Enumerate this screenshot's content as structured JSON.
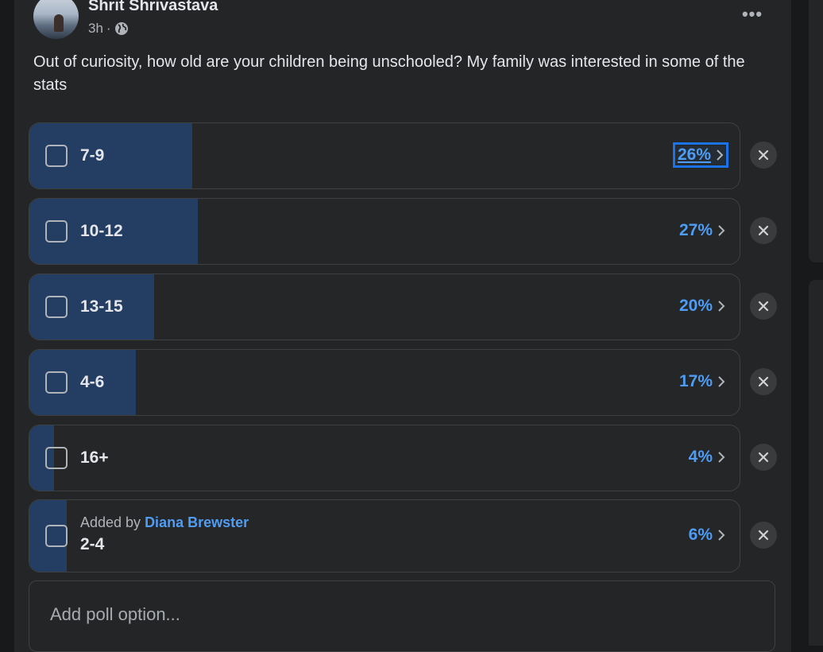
{
  "post": {
    "author": "Shrit Shrivastava",
    "time": "3h",
    "separator": "·",
    "privacy_icon": "globe-icon",
    "more_icon": "more-horizontal-icon",
    "more_label": "•••",
    "question": "Out of curiosity, how old are your children being unschooled? My family was interested in some of the stats"
  },
  "poll": {
    "options": [
      {
        "label": "7-9",
        "percent_text": "26%",
        "percent": 26
      },
      {
        "label": "10-12",
        "percent_text": "27%",
        "percent": 27
      },
      {
        "label": "13-15",
        "percent_text": "20%",
        "percent": 20
      },
      {
        "label": "4-6",
        "percent_text": "17%",
        "percent": 17
      },
      {
        "label": "16+",
        "percent_text": "4%",
        "percent": 4
      },
      {
        "label": "2-4",
        "percent_text": "6%",
        "percent": 6,
        "added_by_prefix": "Added by",
        "added_by_name": "Diana Brewster"
      }
    ],
    "add_option_placeholder": "Add poll option..."
  },
  "colors": {
    "background": "#242526",
    "fill": "#233d63",
    "accent": "#4f9cf5"
  }
}
